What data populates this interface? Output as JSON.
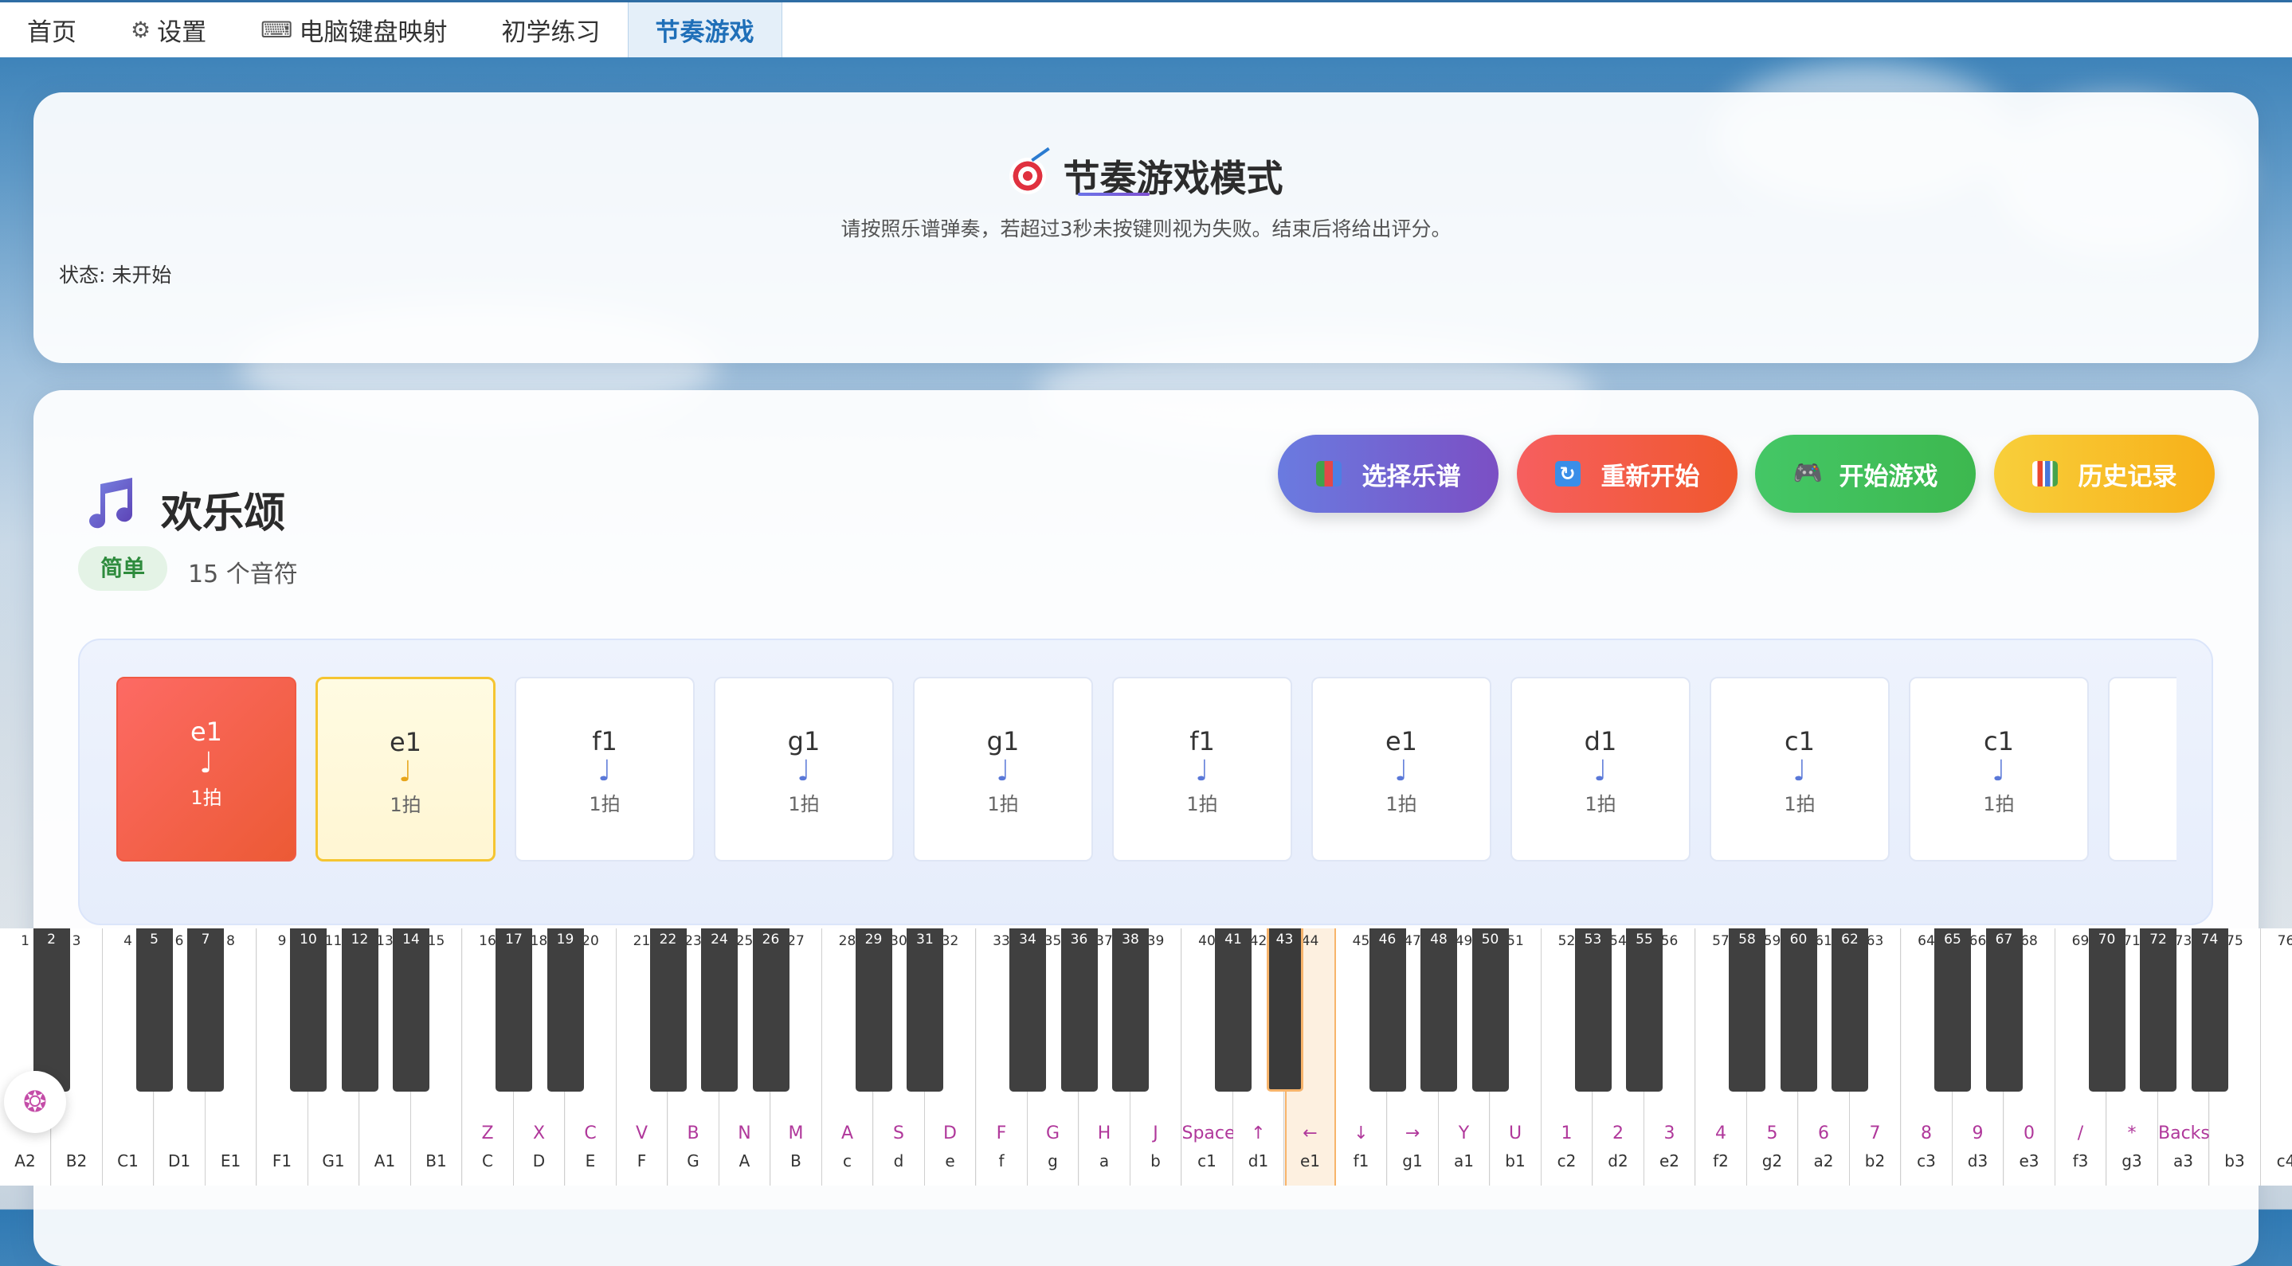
{
  "nav": {
    "tabs": [
      {
        "label": "首页",
        "icon": ""
      },
      {
        "label": "设置",
        "icon": "gear-icon"
      },
      {
        "label": "电脑键盘映射",
        "icon": "keyboard-icon"
      },
      {
        "label": "初学练习",
        "icon": ""
      },
      {
        "label": "节奏游戏",
        "icon": "",
        "active": true
      }
    ]
  },
  "game": {
    "title": "节奏游戏模式",
    "title_icon": "target-icon",
    "subtitle": "请按照乐谱弹奏，若超过3秒未按键则视为失败。结束后将给出评分。",
    "status": "状态: 未开始"
  },
  "song": {
    "icon": "music-notes-icon",
    "title": "欢乐颂",
    "difficulty": "简单",
    "note_count": "15 个音符"
  },
  "buttons": {
    "select": {
      "label": "选择乐谱",
      "icon": "books-icon"
    },
    "restart": {
      "label": "重新开始",
      "icon": "refresh-icon"
    },
    "start": {
      "label": "开始游戏",
      "icon": "gamepad-icon"
    },
    "history": {
      "label": "历史记录",
      "icon": "chart-icon"
    }
  },
  "score": {
    "notes": [
      {
        "name": "e1",
        "symbol": "♩",
        "beats": "1拍",
        "state": "played"
      },
      {
        "name": "e1",
        "symbol": "♩",
        "beats": "1拍",
        "state": "current"
      },
      {
        "name": "f1",
        "symbol": "♩",
        "beats": "1拍",
        "state": "pending"
      },
      {
        "name": "g1",
        "symbol": "♩",
        "beats": "1拍",
        "state": "pending"
      },
      {
        "name": "g1",
        "symbol": "♩",
        "beats": "1拍",
        "state": "pending"
      },
      {
        "name": "f1",
        "symbol": "♩",
        "beats": "1拍",
        "state": "pending"
      },
      {
        "name": "e1",
        "symbol": "♩",
        "beats": "1拍",
        "state": "pending"
      },
      {
        "name": "d1",
        "symbol": "♩",
        "beats": "1拍",
        "state": "pending"
      },
      {
        "name": "c1",
        "symbol": "♩",
        "beats": "1拍",
        "state": "pending"
      },
      {
        "name": "c1",
        "symbol": "♩",
        "beats": "1拍",
        "state": "pending"
      },
      {
        "name": "",
        "symbol": "",
        "beats": "",
        "state": "pending"
      }
    ]
  },
  "piano": {
    "highlight_white": 25,
    "highlight_black": 43,
    "white_keys": [
      {
        "num": "1",
        "key": "",
        "note": "A2"
      },
      {
        "num": "3",
        "key": "",
        "note": "B2"
      },
      {
        "num": "4",
        "key": "",
        "note": "C1"
      },
      {
        "num": "6",
        "key": "",
        "note": "D1"
      },
      {
        "num": "8",
        "key": "",
        "note": "E1"
      },
      {
        "num": "9",
        "key": "",
        "note": "F1"
      },
      {
        "num": "11",
        "key": "",
        "note": "G1"
      },
      {
        "num": "13",
        "key": "",
        "note": "A1"
      },
      {
        "num": "15",
        "key": "",
        "note": "B1"
      },
      {
        "num": "16",
        "key": "Z",
        "note": "C"
      },
      {
        "num": "18",
        "key": "X",
        "note": "D"
      },
      {
        "num": "20",
        "key": "C",
        "note": "E"
      },
      {
        "num": "21",
        "key": "V",
        "note": "F"
      },
      {
        "num": "23",
        "key": "B",
        "note": "G"
      },
      {
        "num": "25",
        "key": "N",
        "note": "A"
      },
      {
        "num": "27",
        "key": "M",
        "note": "B"
      },
      {
        "num": "28",
        "key": "A",
        "note": "c"
      },
      {
        "num": "30",
        "key": "S",
        "note": "d"
      },
      {
        "num": "32",
        "key": "D",
        "note": "e"
      },
      {
        "num": "33",
        "key": "F",
        "note": "f"
      },
      {
        "num": "35",
        "key": "G",
        "note": "g"
      },
      {
        "num": "37",
        "key": "H",
        "note": "a"
      },
      {
        "num": "39",
        "key": "J",
        "note": "b"
      },
      {
        "num": "40",
        "key": "Space",
        "note": "c1"
      },
      {
        "num": "42",
        "key": "↑",
        "note": "d1"
      },
      {
        "num": "44",
        "key": "←",
        "note": "e1"
      },
      {
        "num": "45",
        "key": "↓",
        "note": "f1"
      },
      {
        "num": "47",
        "key": "→",
        "note": "g1"
      },
      {
        "num": "49",
        "key": "Y",
        "note": "a1"
      },
      {
        "num": "51",
        "key": "U",
        "note": "b1"
      },
      {
        "num": "52",
        "key": "1",
        "note": "c2"
      },
      {
        "num": "54",
        "key": "2",
        "note": "d2"
      },
      {
        "num": "56",
        "key": "3",
        "note": "e2"
      },
      {
        "num": "57",
        "key": "4",
        "note": "f2"
      },
      {
        "num": "59",
        "key": "5",
        "note": "g2"
      },
      {
        "num": "61",
        "key": "6",
        "note": "a2"
      },
      {
        "num": "63",
        "key": "7",
        "note": "b2"
      },
      {
        "num": "64",
        "key": "8",
        "note": "c3"
      },
      {
        "num": "66",
        "key": "9",
        "note": "d3"
      },
      {
        "num": "68",
        "key": "0",
        "note": "e3"
      },
      {
        "num": "69",
        "key": "/",
        "note": "f3"
      },
      {
        "num": "71",
        "key": "*",
        "note": "g3"
      },
      {
        "num": "73",
        "key": "Backsp",
        "note": "a3"
      },
      {
        "num": "75",
        "key": "",
        "note": "b3"
      },
      {
        "num": "76",
        "key": "",
        "note": "c4"
      }
    ],
    "black_keys": [
      {
        "num": "2",
        "after": 0
      },
      {
        "num": "5",
        "after": 2
      },
      {
        "num": "7",
        "after": 3
      },
      {
        "num": "10",
        "after": 5
      },
      {
        "num": "12",
        "after": 6
      },
      {
        "num": "14",
        "after": 7
      },
      {
        "num": "17",
        "after": 9
      },
      {
        "num": "19",
        "after": 10
      },
      {
        "num": "22",
        "after": 12
      },
      {
        "num": "24",
        "after": 13
      },
      {
        "num": "26",
        "after": 14
      },
      {
        "num": "29",
        "after": 16
      },
      {
        "num": "31",
        "after": 17
      },
      {
        "num": "34",
        "after": 19
      },
      {
        "num": "36",
        "after": 20
      },
      {
        "num": "38",
        "after": 21
      },
      {
        "num": "41",
        "after": 23
      },
      {
        "num": "43",
        "after": 24
      },
      {
        "num": "46",
        "after": 26
      },
      {
        "num": "48",
        "after": 27
      },
      {
        "num": "50",
        "after": 28
      },
      {
        "num": "53",
        "after": 30
      },
      {
        "num": "55",
        "after": 31
      },
      {
        "num": "58",
        "after": 33
      },
      {
        "num": "60",
        "after": 34
      },
      {
        "num": "62",
        "after": 35
      },
      {
        "num": "65",
        "after": 37
      },
      {
        "num": "67",
        "after": 38
      },
      {
        "num": "70",
        "after": 40
      },
      {
        "num": "72",
        "after": 41
      },
      {
        "num": "74",
        "after": 42
      }
    ]
  },
  "floating": {
    "icon": "brain-icon"
  }
}
